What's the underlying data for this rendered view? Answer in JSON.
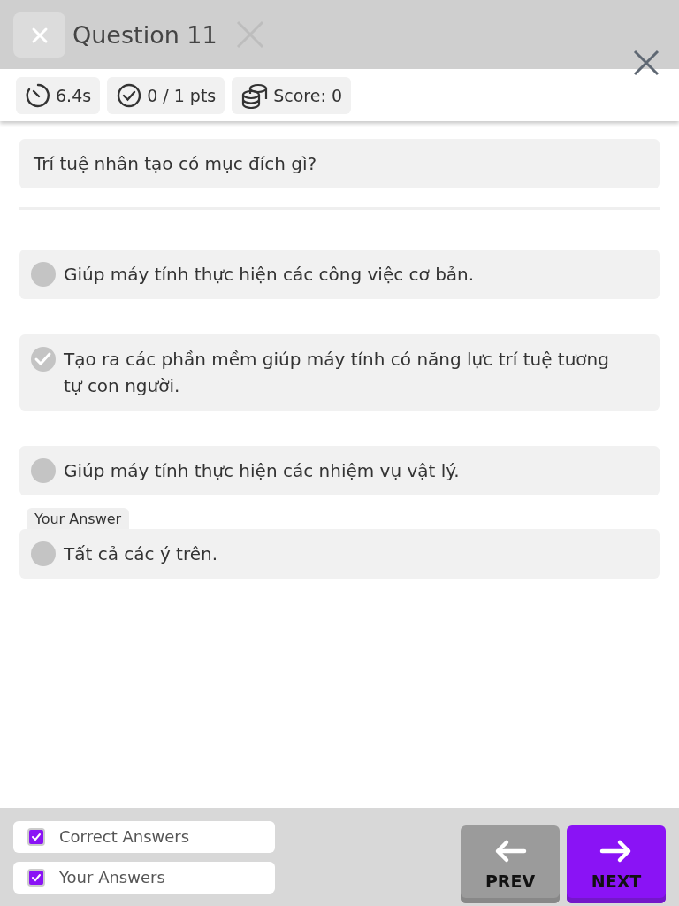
{
  "header": {
    "title": "Question 11"
  },
  "stats": [
    {
      "kind": "timer",
      "text": "6.4s"
    },
    {
      "kind": "points",
      "text": "0 / 1 pts"
    },
    {
      "kind": "score",
      "text": "Score: 0"
    }
  ],
  "question": "Trí tuệ nhân tạo có mục đích gì?",
  "options": [
    {
      "text": "Giúp máy tính thực hiện các công việc cơ bản.",
      "selected": false
    },
    {
      "text": "Tạo ra các phần mềm giúp máy tính có năng lực trí tuệ tương tự con người.",
      "selected": true
    },
    {
      "text": "Giúp máy tính thực hiện các nhiệm vụ vật lý.",
      "selected": false
    },
    {
      "text": "Tất cả các ý trên.",
      "selected": false,
      "tag": "Your Answer"
    }
  ],
  "filters": [
    {
      "label": "Correct Answers",
      "checked": true
    },
    {
      "label": "Your Answers",
      "checked": true
    }
  ],
  "buttons": [
    {
      "kind": "prev",
      "label": "PREV"
    },
    {
      "kind": "next",
      "label": "NEXT"
    }
  ]
}
